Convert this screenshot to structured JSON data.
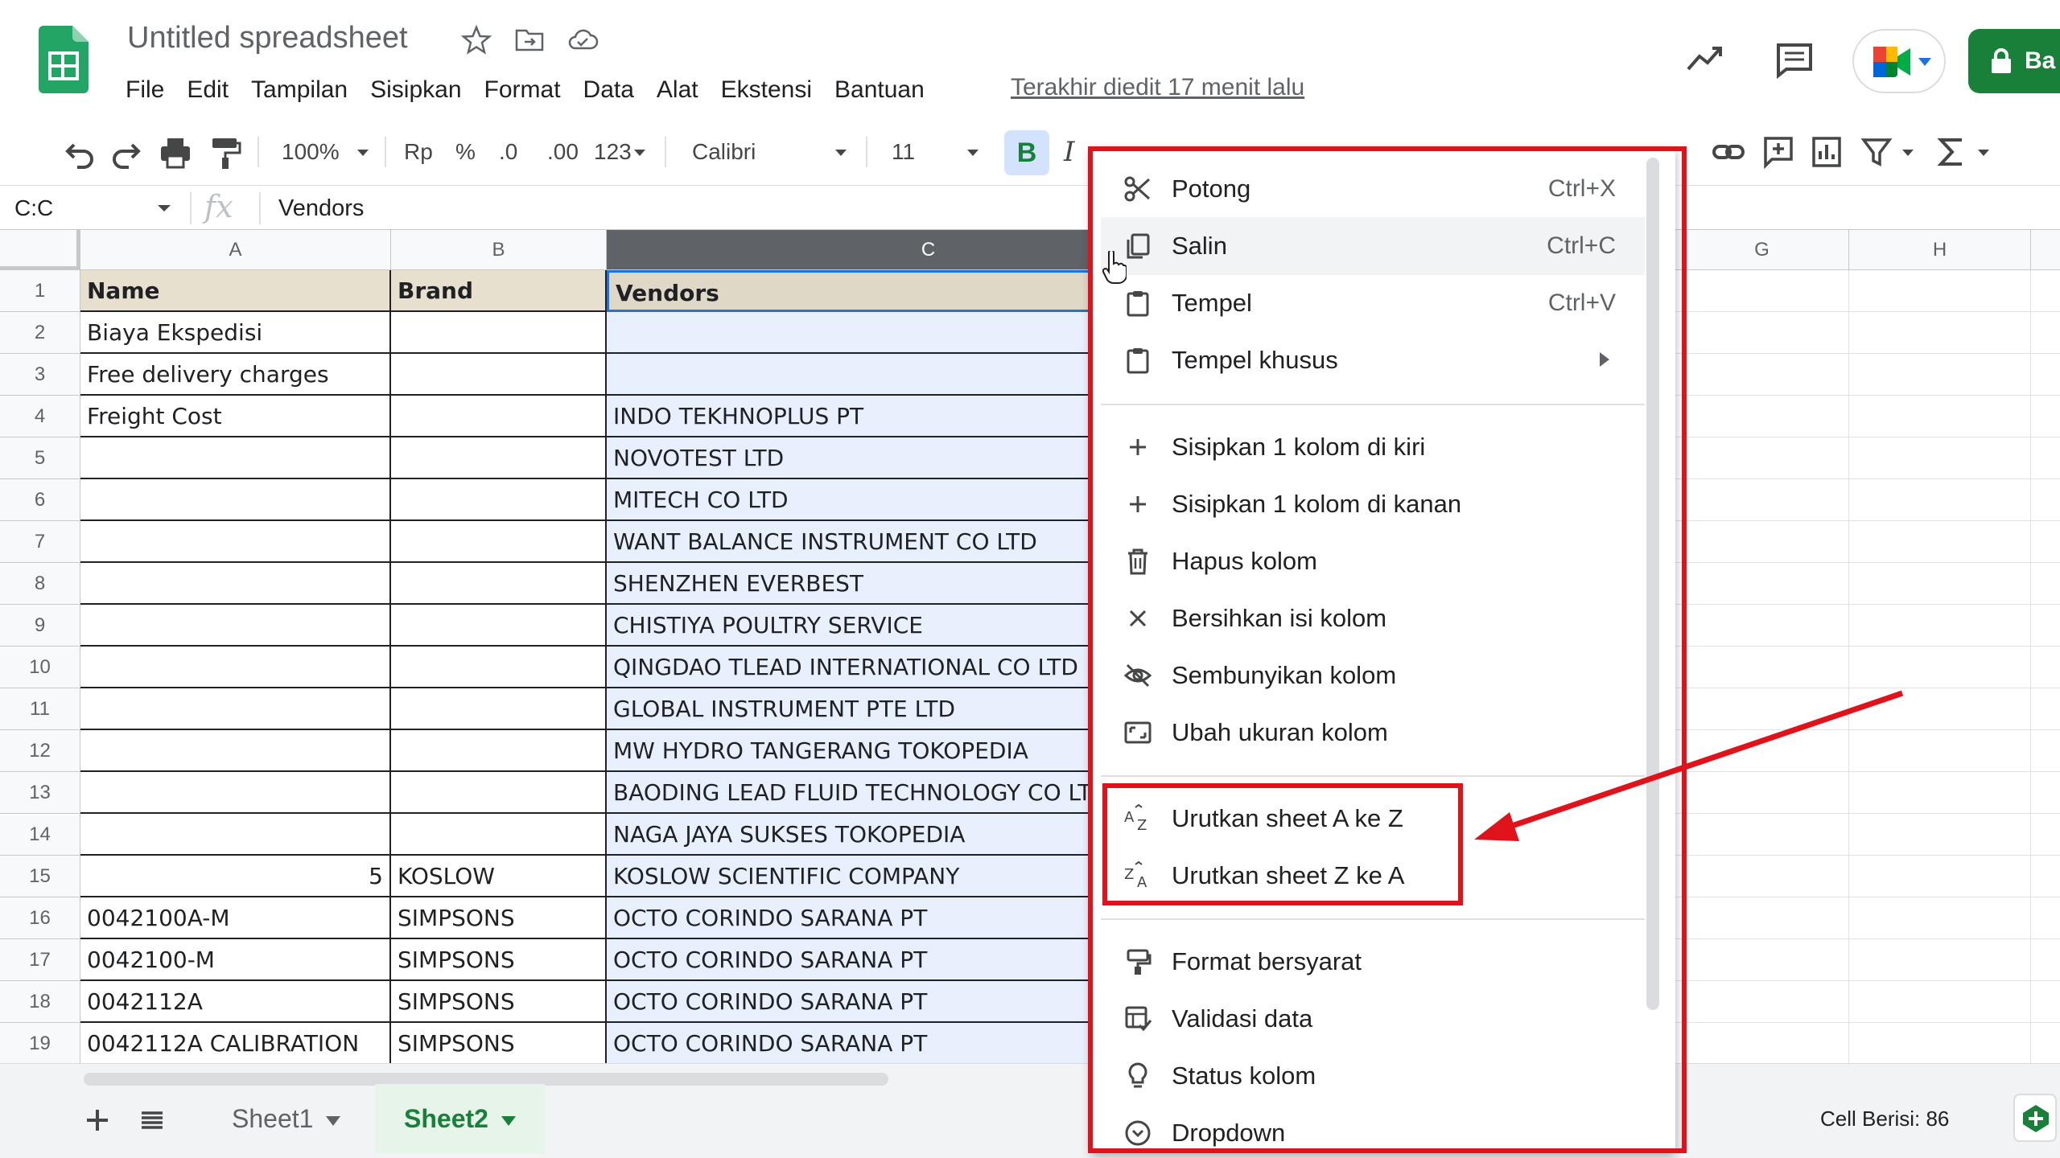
{
  "header": {
    "title": "Untitled spreadsheet",
    "menu": [
      "File",
      "Edit",
      "Tampilan",
      "Sisipkan",
      "Format",
      "Data",
      "Alat",
      "Ekstensi",
      "Bantuan"
    ],
    "last_edit": "Terakhir diedit 17 menit lalu",
    "share_label": "Ba",
    "icons": [
      "sheets-logo-icon",
      "star-icon",
      "move-folder-icon",
      "cloud-saved-icon",
      "trend-icon",
      "comments-icon",
      "meet-icon",
      "lock-icon"
    ]
  },
  "toolbar": {
    "zoom": "100%",
    "currency": "Rp",
    "percent": "%",
    "decrease_decimal": ".0",
    "increase_decimal": ".00",
    "more_formats": "123",
    "font": "Calibri",
    "font_size": "11",
    "bold": "B",
    "italic": "I"
  },
  "formula_bar": {
    "name_box": "C:C",
    "fx": "fx",
    "value": "Vendors"
  },
  "grid": {
    "columns": [
      "A",
      "B",
      "C",
      "G",
      "H"
    ],
    "row_numbers": [
      "1",
      "2",
      "3",
      "4",
      "5",
      "6",
      "7",
      "8",
      "9",
      "10",
      "11",
      "12",
      "13",
      "14",
      "15",
      "16",
      "17",
      "18",
      "19"
    ],
    "rows": [
      [
        "Name",
        "Brand",
        "Vendors"
      ],
      [
        "Biaya Ekspedisi",
        "",
        ""
      ],
      [
        "Free delivery charges",
        "",
        ""
      ],
      [
        "Freight Cost",
        "",
        "INDO TEKHNOPLUS PT"
      ],
      [
        "",
        "",
        "NOVOTEST LTD"
      ],
      [
        "",
        "",
        "MITECH CO LTD"
      ],
      [
        "",
        "",
        "WANT BALANCE INSTRUMENT CO LTD"
      ],
      [
        "",
        "",
        "SHENZHEN EVERBEST"
      ],
      [
        "",
        "",
        "CHISTIYA POULTRY SERVICE"
      ],
      [
        "",
        "",
        "QINGDAO TLEAD INTERNATIONAL CO LTD"
      ],
      [
        "",
        "",
        "GLOBAL INSTRUMENT PTE LTD"
      ],
      [
        "",
        "",
        "MW HYDRO TANGERANG TOKOPEDIA"
      ],
      [
        "",
        "",
        "BAODING LEAD FLUID TECHNOLOGY CO LTD"
      ],
      [
        "",
        "",
        "NAGA JAYA SUKSES TOKOPEDIA"
      ],
      [
        "5",
        "KOSLOW",
        "KOSLOW SCIENTIFIC COMPANY"
      ],
      [
        "0042100A-M",
        "SIMPSONS",
        "OCTO CORINDO SARANA PT"
      ],
      [
        "0042100-M",
        "SIMPSONS",
        "OCTO CORINDO SARANA PT"
      ],
      [
        "0042112A",
        "SIMPSONS",
        "OCTO CORINDO SARANA PT"
      ],
      [
        "0042112A CALIBRATION",
        "SIMPSONS",
        "OCTO CORINDO SARANA PT"
      ]
    ]
  },
  "context_menu": {
    "items": [
      {
        "label": "Potong",
        "shortcut": "Ctrl+X",
        "icon": "scissors-icon"
      },
      {
        "label": "Salin",
        "shortcut": "Ctrl+C",
        "icon": "copy-icon"
      },
      {
        "label": "Tempel",
        "shortcut": "Ctrl+V",
        "icon": "paste-icon"
      },
      {
        "label": "Tempel khusus",
        "shortcut": "",
        "icon": "paste-special-icon"
      },
      {
        "label": "Sisipkan 1 kolom di kiri",
        "shortcut": "",
        "icon": "plus-icon"
      },
      {
        "label": "Sisipkan 1 kolom di kanan",
        "shortcut": "",
        "icon": "plus-icon"
      },
      {
        "label": "Hapus kolom",
        "shortcut": "",
        "icon": "trash-icon"
      },
      {
        "label": "Bersihkan isi kolom",
        "shortcut": "",
        "icon": "close-icon"
      },
      {
        "label": "Sembunyikan kolom",
        "shortcut": "",
        "icon": "eye-off-icon"
      },
      {
        "label": "Ubah ukuran kolom",
        "shortcut": "",
        "icon": "resize-icon"
      },
      {
        "label": "Urutkan sheet A ke Z",
        "shortcut": "",
        "icon": "sort-az-icon"
      },
      {
        "label": "Urutkan sheet Z ke A",
        "shortcut": "",
        "icon": "sort-za-icon"
      },
      {
        "label": "Format bersyarat",
        "shortcut": "",
        "icon": "paint-roller-icon"
      },
      {
        "label": "Validasi data",
        "shortcut": "",
        "icon": "data-validation-icon"
      },
      {
        "label": "Status kolom",
        "shortcut": "",
        "icon": "lightbulb-icon"
      },
      {
        "label": "Dropdown",
        "shortcut": "",
        "icon": "dropdown-circle-icon"
      }
    ]
  },
  "bottom": {
    "sheets": [
      "Sheet1",
      "Sheet2"
    ],
    "active_sheet": "Sheet2",
    "status": "Cell Berisi: 86"
  },
  "colors": {
    "accent_green": "#188038",
    "annotation_red": "#e0131b",
    "selection_blue": "#1a73e8",
    "header_fill": "#e8e0ce",
    "selected_column_fill": "#e8f0fe"
  }
}
